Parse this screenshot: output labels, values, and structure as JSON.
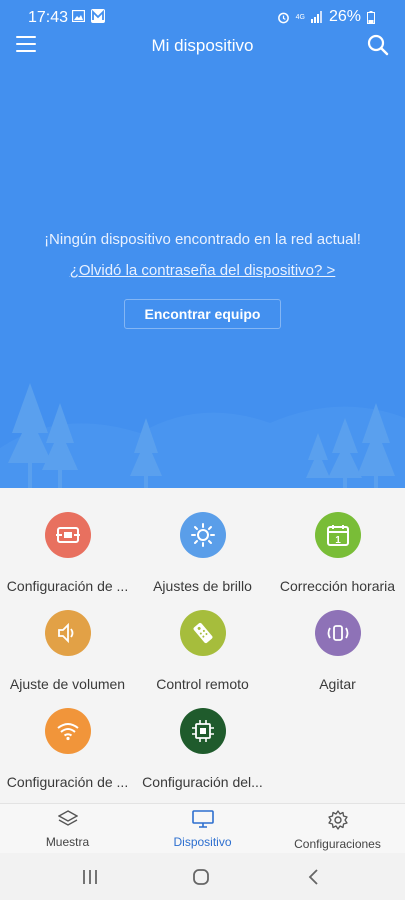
{
  "status_bar": {
    "time": "17:43",
    "battery": "26%",
    "network": "4G"
  },
  "header": {
    "title": "Mi dispositivo"
  },
  "empty_state": {
    "message": "¡Ningún dispositivo encontrado en la red actual!",
    "forgot_link": "¿Olvidó la contraseña del dispositivo? >",
    "find_button": "Encontrar equipo"
  },
  "features": [
    {
      "label": "Configuración de ...",
      "icon": "screen-config-icon",
      "color": "#e8705f"
    },
    {
      "label": "Ajustes de brillo",
      "icon": "brightness-icon",
      "color": "#5a9ee9"
    },
    {
      "label": "Corrección horaria",
      "icon": "calendar-icon",
      "color": "#79bd37"
    },
    {
      "label": "Ajuste de volumen",
      "icon": "volume-icon",
      "color": "#e2a146"
    },
    {
      "label": "Control remoto",
      "icon": "remote-control-icon",
      "color": "#a6bd3c"
    },
    {
      "label": "Agitar",
      "icon": "shake-icon",
      "color": "#8e72b7"
    },
    {
      "label": "Configuración de ...",
      "icon": "wifi-icon",
      "color": "#f1953a"
    },
    {
      "label": "Configuración del...",
      "icon": "chip-icon",
      "color": "#1f5b2c"
    }
  ],
  "calendar_day": "1",
  "bottom_nav": {
    "sample": "Muestra",
    "device": "Dispositivo",
    "settings": "Configuraciones"
  },
  "colors": {
    "hero": "#4390ef",
    "active_tab": "#2d6fcf"
  }
}
